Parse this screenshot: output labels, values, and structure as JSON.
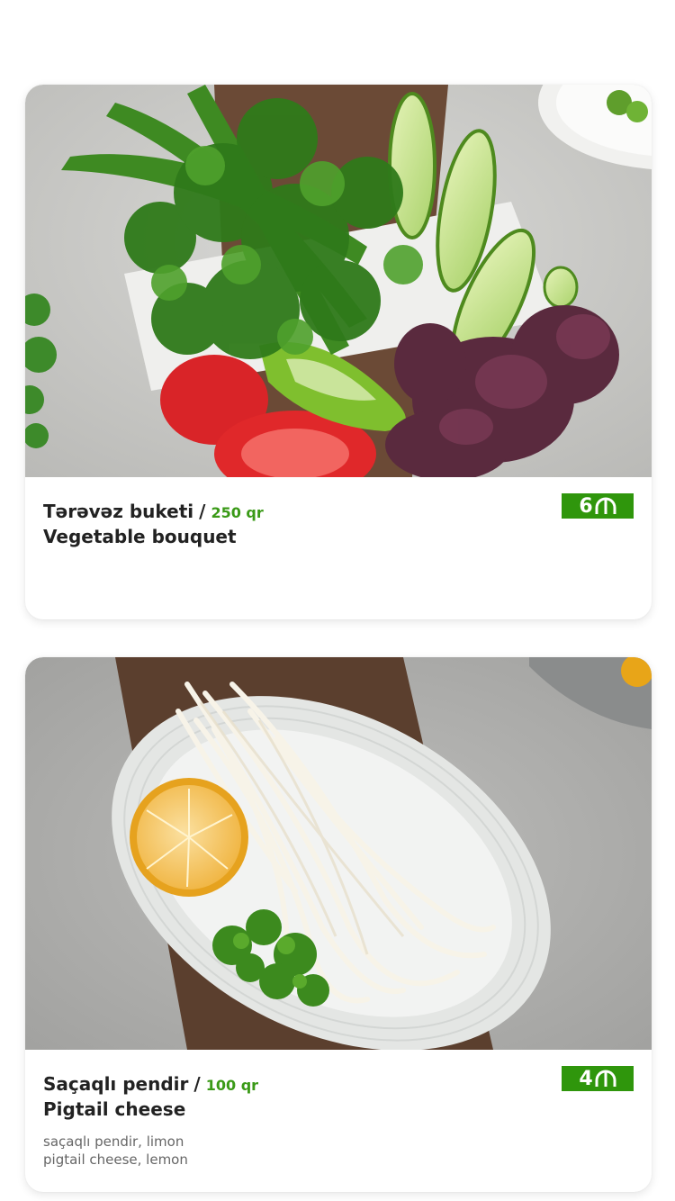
{
  "menu_items": [
    {
      "name_az": "Tərəvəz buketi",
      "separator": "/",
      "weight": "250 qr",
      "name_en": "Vegetable bouquet",
      "price": "6",
      "currency_icon": "manat-icon",
      "ingredients_az": "",
      "ingredients_en": "",
      "image": "vegetable-bouquet-photo"
    },
    {
      "name_az": "Saçaqlı pendir",
      "separator": "/",
      "weight": "100 qr",
      "name_en": "Pigtail cheese",
      "price": "4",
      "currency_icon": "manat-icon",
      "ingredients_az": "saçaqlı pendir, limon",
      "ingredients_en": "pigtail cheese, lemon",
      "image": "pigtail-cheese-photo"
    }
  ],
  "colors": {
    "price_badge": "#2f960c",
    "weight_text": "#3a9a17",
    "title_text": "#222222",
    "ingredient_text": "#666666"
  }
}
